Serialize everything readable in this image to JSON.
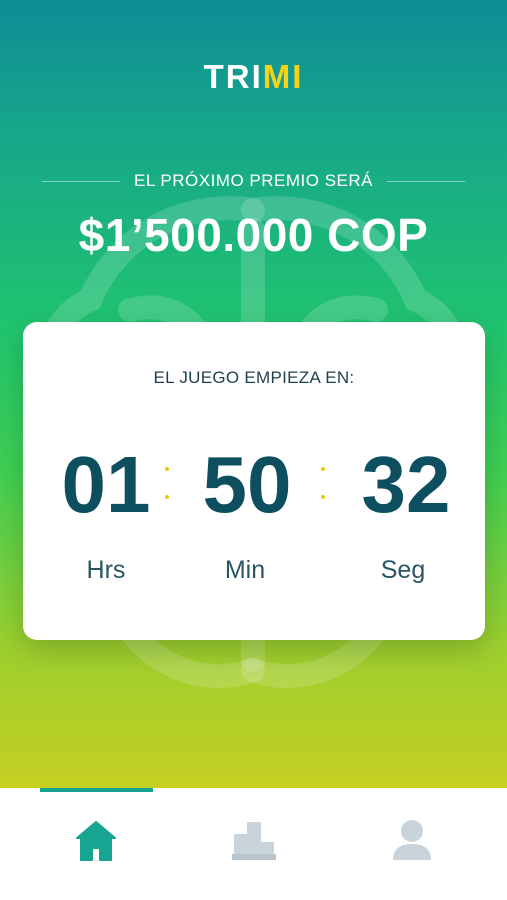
{
  "app": {
    "logo_text_main": "TRI",
    "logo_text_accent": "MI"
  },
  "prize": {
    "label": "EL PRÓXIMO PREMIO SERÁ",
    "amount": "$1’500.000 COP"
  },
  "countdown": {
    "title": "EL JUEGO EMPIEZA EN:",
    "hours": "01",
    "minutes": "50",
    "seconds": "32",
    "hours_label": "Hrs",
    "minutes_label": "Min",
    "seconds_label": "Seg"
  },
  "tabbar": {
    "active_tab": "home",
    "tabs": [
      {
        "name": "home",
        "icon": "home-icon"
      },
      {
        "name": "ranking",
        "icon": "podium-icon"
      },
      {
        "name": "profile",
        "icon": "user-icon"
      }
    ]
  },
  "colors": {
    "accent_yellow": "#f5d21c",
    "digits": "#0d4f5e",
    "active_tab": "#17a591",
    "inactive_tab": "#c9d3da"
  }
}
